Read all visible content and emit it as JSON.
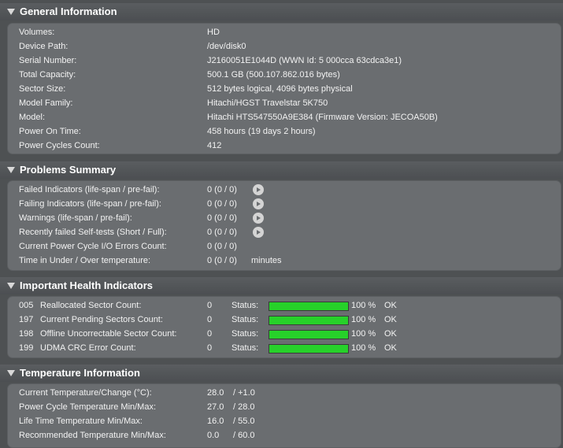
{
  "general": {
    "title": "General Information",
    "rows": [
      {
        "label": "Volumes:",
        "value": "HD"
      },
      {
        "label": "Device Path:",
        "value": "/dev/disk0"
      },
      {
        "label": "Serial Number:",
        "value": "J2160051E1044D (WWN Id: 5 000cca 63cdca3e1)"
      },
      {
        "label": "Total Capacity:",
        "value": "500.1 GB (500.107.862.016 bytes)"
      },
      {
        "label": "Sector Size:",
        "value": "512 bytes logical, 4096 bytes physical"
      },
      {
        "label": "Model Family:",
        "value": "Hitachi/HGST Travelstar 5K750"
      },
      {
        "label": "Model:",
        "value": "Hitachi HTS547550A9E384  (Firmware Version: JECOA50B)"
      },
      {
        "label": "Power On Time:",
        "value": "458 hours (19 days 2 hours)"
      },
      {
        "label": "Power Cycles Count:",
        "value": "412"
      }
    ]
  },
  "problems": {
    "title": "Problems Summary",
    "rows": [
      {
        "label": "Failed Indicators (life-span / pre-fail):",
        "value": "0  (0 / 0)"
      },
      {
        "label": "Failing Indicators (life-span / pre-fail):",
        "value": "0  (0 / 0)"
      },
      {
        "label": "Warnings (life-span / pre-fail):",
        "value": "0  (0 / 0)"
      },
      {
        "label": "Recently failed Self-tests (Short / Full):",
        "value": "0  (0 / 0)"
      },
      {
        "label": "Current Power Cycle I/O Errors Count:",
        "value": "0  (0 / 0)"
      },
      {
        "label": "Time in Under / Over temperature:",
        "value": "0  (0 / 0)",
        "unit": "minutes"
      }
    ]
  },
  "health": {
    "title": "Important Health Indicators",
    "status_label": "Status:",
    "rows": [
      {
        "id": "005",
        "label": "Reallocated Sector Count:",
        "value": "0",
        "percent": 100,
        "percent_text": "100 %",
        "status": "OK"
      },
      {
        "id": "197",
        "label": "Current Pending Sectors Count:",
        "value": "0",
        "percent": 100,
        "percent_text": "100 %",
        "status": "OK"
      },
      {
        "id": "198",
        "label": "Offline Uncorrectable Sector Count:",
        "value": "0",
        "percent": 100,
        "percent_text": "100 %",
        "status": "OK"
      },
      {
        "id": "199",
        "label": "UDMA CRC Error Count:",
        "value": "0",
        "percent": 100,
        "percent_text": "100 %",
        "status": "OK"
      }
    ],
    "bar_color": "#27d12a"
  },
  "temperature": {
    "title": "Temperature Information",
    "rows": [
      {
        "label": "Current Temperature/Change (°C):",
        "value": "28.0",
        "sep": "/ +1.0"
      },
      {
        "label": "Power Cycle Temperature Min/Max:",
        "value": "27.0",
        "sep": "/ 28.0"
      },
      {
        "label": "Life Time Temperature Min/Max:",
        "value": "16.0",
        "sep": "/ 55.0"
      },
      {
        "label": "Recommended Temperature Min/Max:",
        "value": "0.0",
        "sep": "/ 60.0"
      }
    ]
  }
}
